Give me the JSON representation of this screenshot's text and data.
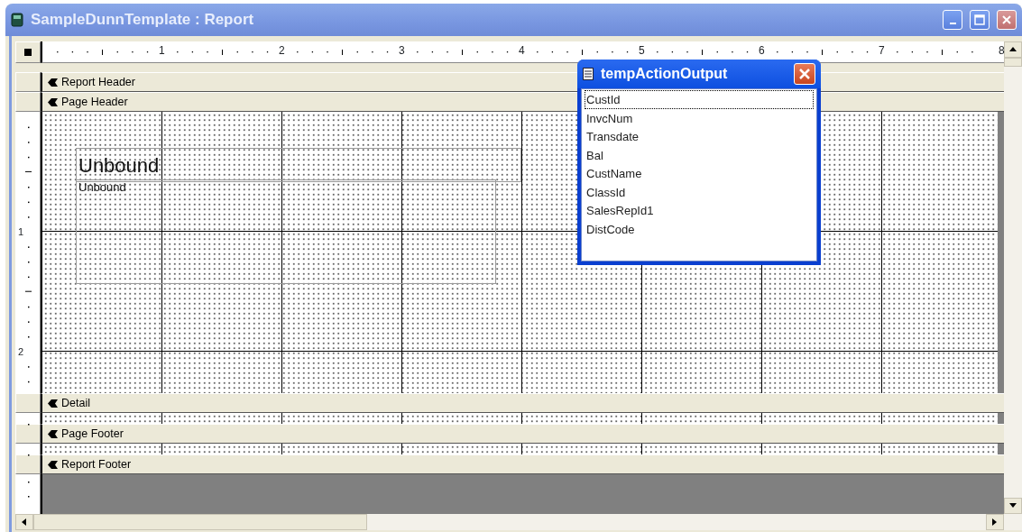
{
  "window": {
    "title": "SampleDunnTemplate : Report"
  },
  "horizontal_ruler": {
    "labels": [
      "1",
      "2",
      "3",
      "4",
      "5",
      "6",
      "7",
      "8"
    ]
  },
  "vertical_ruler": {
    "labels": [
      "1",
      "2"
    ]
  },
  "sections": [
    {
      "label": "Report Header",
      "has_body": false
    },
    {
      "label": "Page Header",
      "has_body": true,
      "controls": [
        {
          "kind": "label",
          "text": "Unbound"
        },
        {
          "kind": "text_box",
          "text": "Unbound"
        }
      ]
    },
    {
      "label": "Detail",
      "has_body": true
    },
    {
      "label": "Page Footer",
      "has_body": true
    },
    {
      "label": "Report Footer",
      "has_body": false
    }
  ],
  "field_list": {
    "title": "tempActionOutput",
    "fields": [
      {
        "name": "CustId",
        "selected": true
      },
      {
        "name": "InvcNum",
        "selected": false
      },
      {
        "name": "Transdate",
        "selected": false
      },
      {
        "name": "Bal",
        "selected": false
      },
      {
        "name": "CustName",
        "selected": false
      },
      {
        "name": "ClassId",
        "selected": false
      },
      {
        "name": "SalesRepId1",
        "selected": false
      },
      {
        "name": "DistCode",
        "selected": false
      }
    ]
  }
}
